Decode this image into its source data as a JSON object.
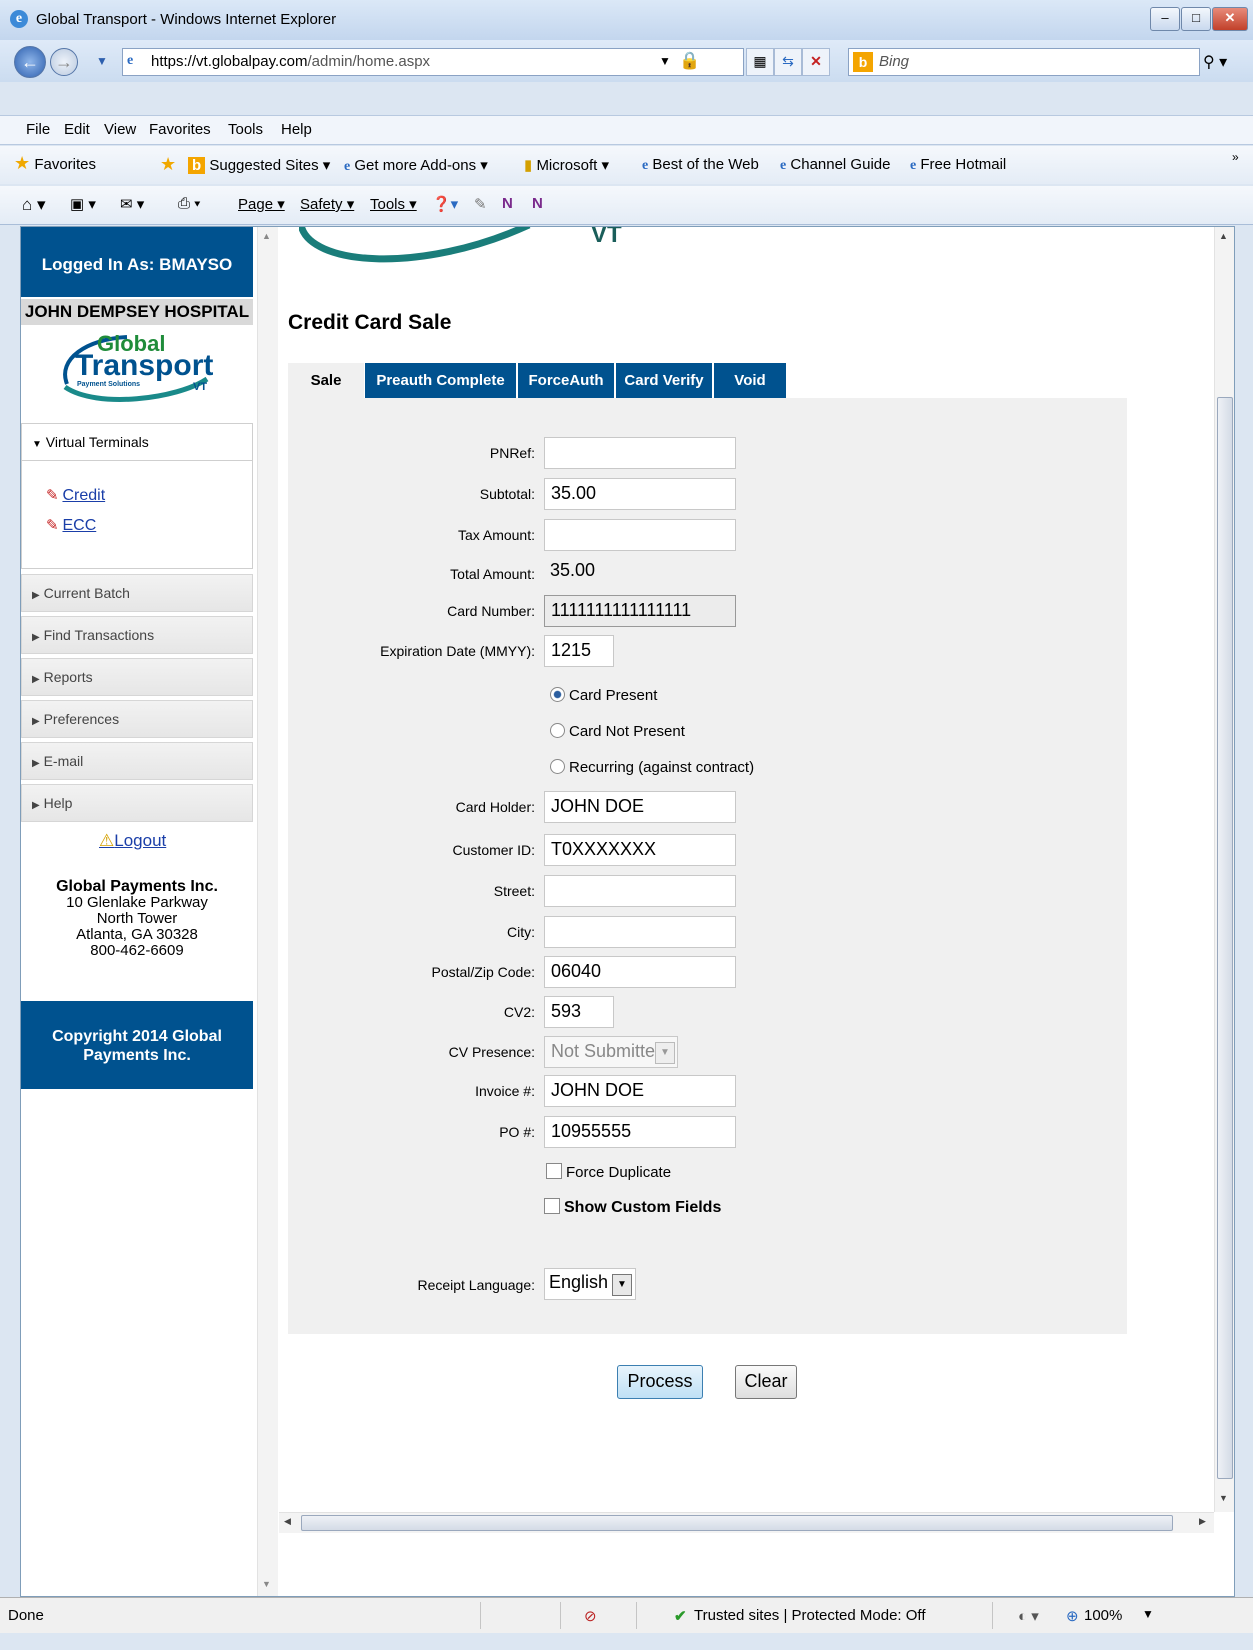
{
  "window": {
    "title": "Global Transport - Windows Internet Explorer",
    "controls": {
      "minimize": "–",
      "maximize": "□",
      "close": "✕"
    }
  },
  "browser": {
    "address_host": "https://vt.globalpay.com",
    "address_path": "/admin/home.aspx",
    "search_placeholder": "Bing",
    "menu": [
      "File",
      "Edit",
      "View",
      "Favorites",
      "Tools",
      "Help"
    ],
    "favorites_bar": {
      "favorites": "Favorites",
      "items": [
        "Suggested Sites ▾",
        "Get more Add-ons ▾",
        "Microsoft ▾",
        "Best of the Web",
        "Channel Guide",
        "Free Hotmail"
      ]
    },
    "command_bar": [
      "Page ▾",
      "Safety ▾",
      "Tools ▾"
    ],
    "status": {
      "left": "Done",
      "zone": "Trusted sites | Protected Mode: Off",
      "zoom": "100%"
    }
  },
  "sidebar": {
    "logged_in": "Logged In As: BMAYSO",
    "hospital": "JOHN DEMPSEY HOSPITAL",
    "logo": {
      "line1": "Global",
      "line2": "Transport",
      "line3": "Payment Solutions",
      "vt": "VT"
    },
    "virtual_terminals": {
      "header": "Virtual Terminals",
      "links": [
        "Credit",
        "ECC"
      ]
    },
    "sections": [
      "Current Batch",
      "Find Transactions",
      "Reports",
      "Preferences",
      "E-mail",
      "Help"
    ],
    "logout": "Logout",
    "company": {
      "name": "Global Payments Inc.",
      "lines": [
        "10 Glenlake Parkway",
        "North Tower",
        "Atlanta, GA 30328",
        "800-462-6609"
      ]
    },
    "copyright": "Copyright 2014 Global Payments Inc."
  },
  "main": {
    "header_logo_text": "VT",
    "title": "Credit Card Sale",
    "tabs": [
      "Sale",
      "Preauth Complete",
      "ForceAuth",
      "Card Verify",
      "Void"
    ],
    "form": {
      "pnref": {
        "label": "PNRef:",
        "value": ""
      },
      "subtotal": {
        "label": "Subtotal:",
        "value": "35.00"
      },
      "tax": {
        "label": "Tax Amount:",
        "value": ""
      },
      "total": {
        "label": "Total Amount:",
        "value": "35.00"
      },
      "card_number": {
        "label": "Card Number:",
        "value": "1111111111111111"
      },
      "expiration": {
        "label": "Expiration Date (MMYY):",
        "value": "1215"
      },
      "presence_options": [
        "Card Present",
        "Card Not Present",
        "Recurring (against contract)"
      ],
      "presence_selected": "Card Present",
      "card_holder": {
        "label": "Card Holder:",
        "value": "JOHN DOE"
      },
      "customer_id": {
        "label": "Customer ID:",
        "value": "T0XXXXXXX"
      },
      "street": {
        "label": "Street:",
        "value": ""
      },
      "city": {
        "label": "City:",
        "value": ""
      },
      "zip": {
        "label": "Postal/Zip Code:",
        "value": "06040"
      },
      "cv2": {
        "label": "CV2:",
        "value": "593"
      },
      "cv_presence": {
        "label": "CV Presence:",
        "value": "Not Submitted"
      },
      "invoice": {
        "label": "Invoice #:",
        "value": "JOHN DOE"
      },
      "po": {
        "label": "PO #:",
        "value": "10955555"
      },
      "force_duplicate": "Force Duplicate",
      "show_custom_fields": "Show Custom Fields",
      "receipt_language": {
        "label": "Receipt Language:",
        "value": "English"
      }
    },
    "buttons": {
      "process": "Process",
      "clear": "Clear"
    }
  },
  "colors": {
    "brand_blue": "#00528f",
    "form_bg": "#f0f0f0",
    "link": "#1a3ea8"
  }
}
